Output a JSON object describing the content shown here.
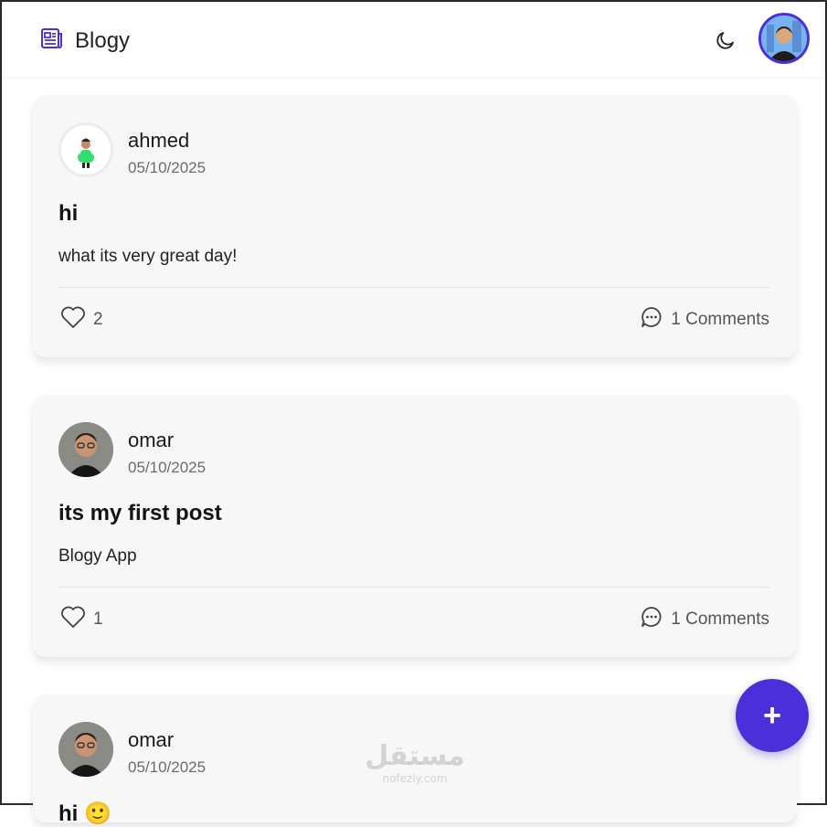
{
  "header": {
    "brand_icon": "newspaper-icon",
    "brand_title": "Blogy",
    "theme_icon": "moon-icon",
    "avatar": "user-avatar"
  },
  "posts": [
    {
      "author": "ahmed",
      "date": "05/10/2025",
      "title": "hi",
      "body": "what its very great day!",
      "likes": "2",
      "comments": "1 Comments"
    },
    {
      "author": "omar",
      "date": "05/10/2025",
      "title": "its my first post",
      "body": "Blogy App",
      "likes": "1",
      "comments": "1 Comments"
    },
    {
      "author": "omar",
      "date": "05/10/2025",
      "title": "hi 🙂"
    }
  ],
  "fab": {
    "label": "+"
  },
  "watermark": {
    "brand": "مستقل",
    "url": "nofezly.com"
  },
  "colors": {
    "accent": "#4b2fd8",
    "card_bg": "#f7f7f7",
    "muted_text": "#6b6b6b"
  }
}
